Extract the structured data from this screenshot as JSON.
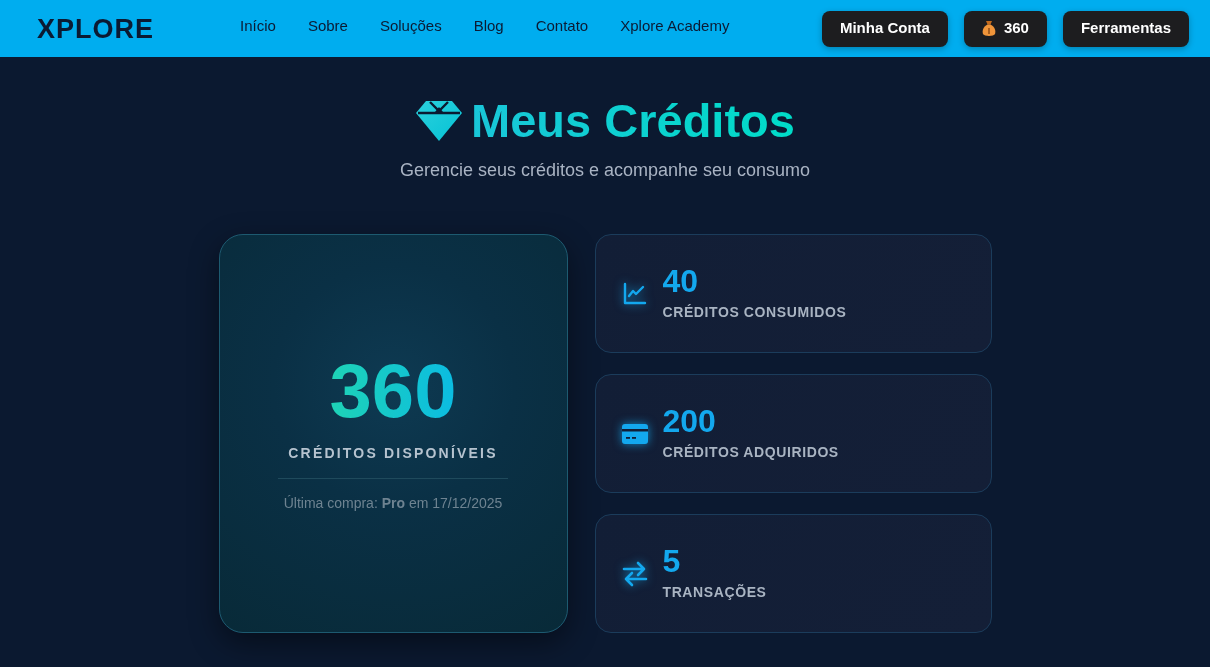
{
  "navbar": {
    "logo": "XPLORE",
    "links": [
      {
        "label": "Início"
      },
      {
        "label": "Sobre"
      },
      {
        "label": "Soluções"
      },
      {
        "label": "Blog"
      },
      {
        "label": "Contato"
      },
      {
        "label": "Xplore Academy"
      }
    ],
    "buttons": [
      {
        "kind": "account",
        "label": "Minha Conta"
      },
      {
        "kind": "credits",
        "label": "360"
      },
      {
        "kind": "tools",
        "label": "Ferramentas"
      }
    ]
  },
  "header": {
    "title": "Meus Créditos",
    "subtitle": "Gerencie seus créditos e acompanhe seu consumo"
  },
  "balance_card": {
    "value": "360",
    "label": "CRÉDITOS DISPONÍVEIS",
    "last_purchase": "Última compra: **Pro** em 17/12/2025"
  },
  "stats": [
    {
      "kind": "consumed",
      "value": "40",
      "label": "CRÉDITOS CONSUMIDOS"
    },
    {
      "kind": "purchased",
      "value": "200",
      "label": "CRÉDITOS ADQUIRIDOS"
    },
    {
      "kind": "transactions",
      "value": "5",
      "label": "TRANSAÇÕES"
    }
  ]
}
